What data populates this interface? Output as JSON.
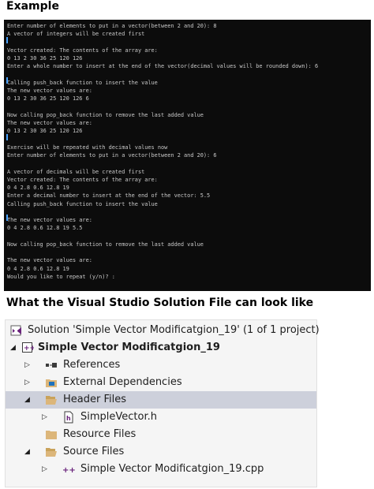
{
  "headings": {
    "example": "Example",
    "solution": "What the Visual Studio Solution File can look like"
  },
  "console": {
    "lines": [
      "Enter number of elements to put in a vector(between 2 and 20): 8",
      "A vector of integers will be created first",
      "",
      "Vector created: The contents of the array are:",
      "0 13 2 30 36 25 120 126",
      "Enter a whole number to insert at the end of the vector(decimal values will be rounded down): 6",
      "",
      "Calling push_back function to insert the value",
      "The new vector values are:",
      "0 13 2 30 36 25 120 126 6",
      "",
      "Now calling pop_back function to remove the last added value",
      "The new vector values are:",
      "0 13 2 30 36 25 120 126",
      "",
      "Exercise will be repeated with decimal values now",
      "Enter number of elements to put in a vector(between 2 and 20): 6",
      "",
      "A vector of decimals will be created first",
      "Vector created: The contents of the array are:",
      "0 4 2.8 0.6 12.8 19",
      "Enter a decimal number to insert at the end of the vector: 5.5",
      "Calling push_back function to insert the value",
      "",
      "The new vector values are:",
      "0 4 2.8 0.6 12.8 19 5.5",
      "",
      "Now calling pop_back function to remove the last added value",
      "",
      "The new vector values are:",
      "0 4 2.8 0.6 12.8 19",
      "Would you like to repeat (y/n)? :"
    ],
    "colors": {
      "background": "#0c0c0c",
      "text": "#c8c8c8",
      "cursor": "#4aa3ff"
    }
  },
  "solution_explorer": {
    "selected_color": "#cdd0db",
    "items": [
      {
        "label": "Solution 'Simple Vector Modificatgion_19' (1 of 1 project)",
        "icon": "solution-icon",
        "expander": ""
      },
      {
        "label": "Simple Vector Modificatgion_19",
        "icon": "cpp-project-icon",
        "expander": "collapse"
      },
      {
        "label": "References",
        "icon": "references-icon",
        "expander": "expand"
      },
      {
        "label": "External Dependencies",
        "icon": "external-dependencies-icon",
        "expander": "expand"
      },
      {
        "label": "Header Files",
        "icon": "folder-open-icon",
        "expander": "collapse"
      },
      {
        "label": "SimpleVector.h",
        "icon": "header-file-icon",
        "expander": "expand"
      },
      {
        "label": "Resource Files",
        "icon": "folder-icon",
        "expander": ""
      },
      {
        "label": "Source Files",
        "icon": "folder-open-icon",
        "expander": "collapse"
      },
      {
        "label": "Simple Vector Modificatgion_19.cpp",
        "icon": "cpp-file-icon",
        "expander": "expand"
      }
    ]
  }
}
